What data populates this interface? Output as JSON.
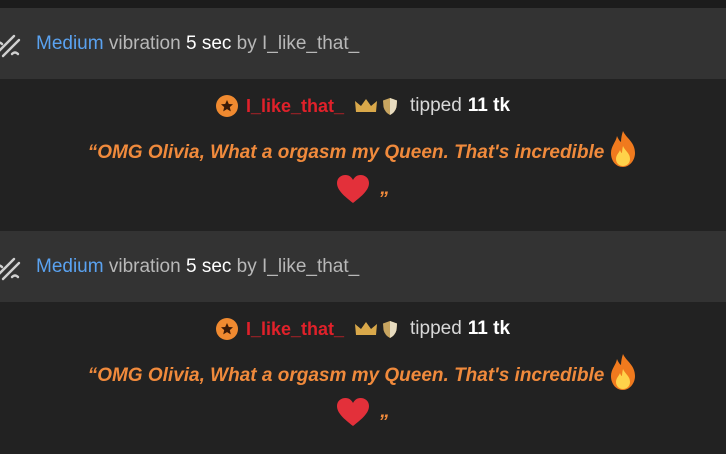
{
  "entries": [
    {
      "notice": {
        "icon": "vibration-icon",
        "level": "Medium",
        "vibration_word": "vibration",
        "duration": "5 sec",
        "by_word": "by",
        "user": "I_like_that_"
      },
      "tip": {
        "user": "I_like_that_",
        "tipped_word": "tipped",
        "amount": "11 tk",
        "message_line1": "“OMG Olivia, What a orgasm my Queen. That's incredible",
        "message_end": "„"
      }
    },
    {
      "notice": {
        "icon": "vibration-icon",
        "level": "Medium",
        "vibration_word": "vibration",
        "duration": "5 sec",
        "by_word": "by",
        "user": "I_like_that_"
      },
      "tip": {
        "user": "I_like_that_",
        "tipped_word": "tipped",
        "amount": "11 tk",
        "message_line1": "“OMG Olivia, What a orgasm my Queen. That's incredible",
        "message_end": "„"
      }
    }
  ],
  "colors": {
    "notice_bg": "#333333",
    "tip_bg": "#222222",
    "level": "#5aa2f0",
    "username": "#e0212a",
    "message": "#f08a3c",
    "badge": "#f08a30",
    "crown": "#d9a84a"
  }
}
